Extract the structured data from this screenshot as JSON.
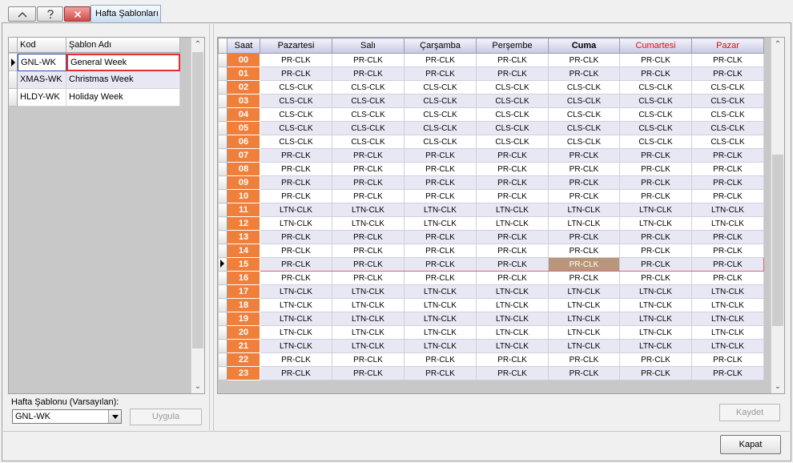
{
  "window": {
    "tab_title": "Hafta Şablonları"
  },
  "templates": {
    "columns": [
      "Kod",
      "Şablon Adı"
    ],
    "rows": [
      {
        "code": "GNL-WK",
        "name": "General Week"
      },
      {
        "code": "XMAS-WK",
        "name": "Christmas Week"
      },
      {
        "code": "HLDY-WK",
        "name": "Holiday Week"
      }
    ],
    "selected_index": 0
  },
  "default_template": {
    "label": "Hafta Şablonu (Varsayılan):",
    "value": "GNL-WK",
    "apply_label": "Uygula"
  },
  "schedule": {
    "hour_header": "Saat",
    "days": [
      "Pazartesi",
      "Salı",
      "Çarşamba",
      "Perşembe",
      "Cuma",
      "Cumartesi",
      "Pazar"
    ],
    "current_day_index": 4,
    "weekend_indices": [
      5,
      6
    ],
    "selected_hour_index": 15,
    "hours": [
      "00",
      "01",
      "02",
      "03",
      "04",
      "05",
      "06",
      "07",
      "08",
      "09",
      "10",
      "11",
      "12",
      "13",
      "14",
      "15",
      "16",
      "17",
      "18",
      "19",
      "20",
      "21",
      "22",
      "23"
    ],
    "values": [
      "PR-CLK",
      "PR-CLK",
      "CLS-CLK",
      "CLS-CLK",
      "CLS-CLK",
      "CLS-CLK",
      "CLS-CLK",
      "PR-CLK",
      "PR-CLK",
      "PR-CLK",
      "PR-CLK",
      "LTN-CLK",
      "LTN-CLK",
      "PR-CLK",
      "PR-CLK",
      "PR-CLK",
      "PR-CLK",
      "LTN-CLK",
      "LTN-CLK",
      "LTN-CLK",
      "LTN-CLK",
      "LTN-CLK",
      "PR-CLK",
      "PR-CLK"
    ]
  },
  "buttons": {
    "save": "Kaydet",
    "close": "Kapat"
  },
  "colors": {
    "hour_cell": "#f07f3c",
    "selection_border": "#e06070",
    "active_cell": "#b8967c",
    "weekend_header": "#e01010"
  }
}
